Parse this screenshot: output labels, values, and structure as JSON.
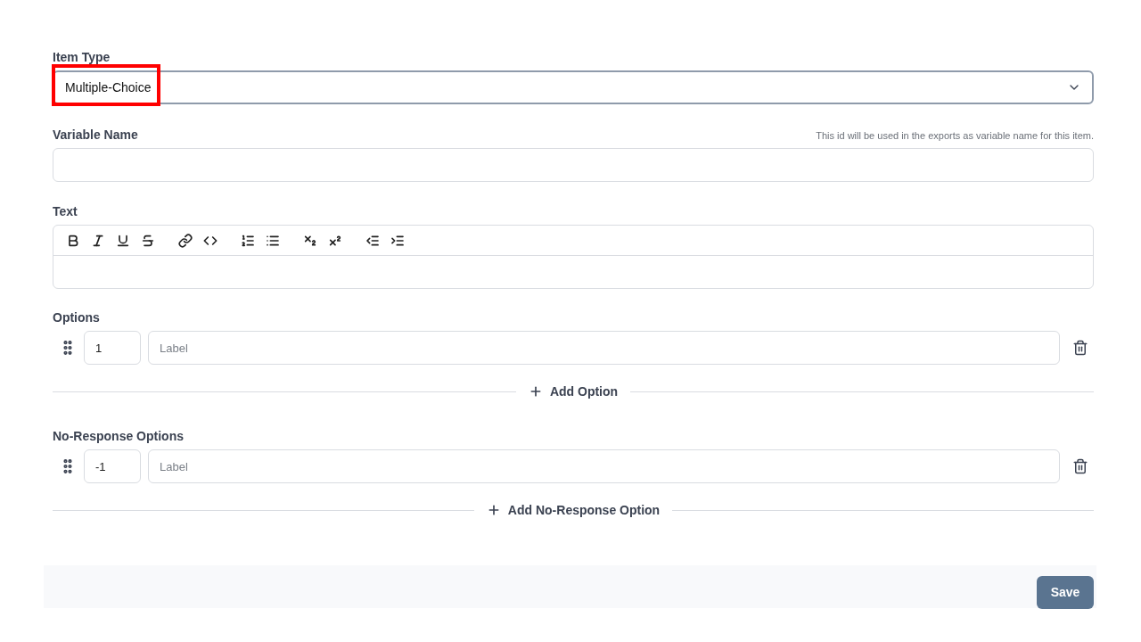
{
  "item_type": {
    "label": "Item Type",
    "value": "Multiple-Choice",
    "highlighted": true
  },
  "variable_name": {
    "label": "Variable Name",
    "hint": "This id will be used in the exports as variable name for this item."
  },
  "text": {
    "label": "Text",
    "toolbar": [
      [
        {
          "kind": "bold"
        },
        {
          "kind": "italic"
        },
        {
          "kind": "underline"
        },
        {
          "kind": "strike"
        }
      ],
      [
        {
          "kind": "link"
        },
        {
          "kind": "code"
        }
      ],
      [
        {
          "kind": "ordered-list"
        },
        {
          "kind": "bullet-list"
        }
      ],
      [
        {
          "kind": "subscript"
        },
        {
          "kind": "superscript"
        }
      ],
      [
        {
          "kind": "outdent"
        },
        {
          "kind": "indent"
        }
      ]
    ]
  },
  "options": {
    "label": "Options",
    "rows": [
      {
        "value": "1",
        "placeholder": "Label"
      }
    ],
    "add_button": "Add Option"
  },
  "no_response_options": {
    "label": "No-Response Options",
    "rows": [
      {
        "value": "-1",
        "placeholder": "Label"
      }
    ],
    "add_button": "Add No-Response Option"
  },
  "footer": {
    "save_button": "Save"
  }
}
